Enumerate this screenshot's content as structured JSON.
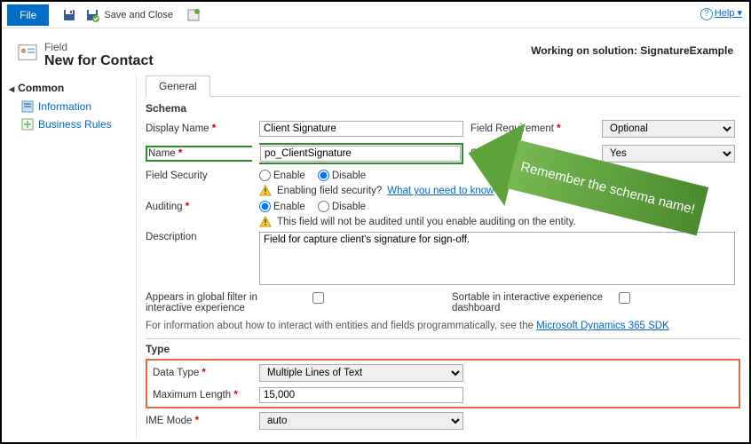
{
  "toolbar": {
    "file_label": "File",
    "save_close_label": "Save and Close",
    "help_label": "Help"
  },
  "header": {
    "entity_type": "Field",
    "title": "New for Contact",
    "solution_prefix": "Working on solution:",
    "solution_name": "SignatureExample"
  },
  "sidebar": {
    "group": "Common",
    "items": [
      {
        "label": "Information"
      },
      {
        "label": "Business Rules"
      }
    ]
  },
  "tabs": {
    "general": "General"
  },
  "schema": {
    "section_title": "Schema",
    "display_name_label": "Display Name",
    "display_name_value": "Client Signature",
    "field_req_label": "Field Requirement",
    "field_req_value": "Optional",
    "name_label": "Name",
    "name_value": "po_ClientSignature",
    "searchable_label": "Searchable",
    "searchable_value": "Yes",
    "field_security_label": "Field Security",
    "enable_label": "Enable",
    "disable_label": "Disable",
    "field_security_warn": "Enabling field security?",
    "field_security_link": "What you need to know",
    "auditing_label": "Auditing",
    "auditing_warn": "This field will not be audited until you enable auditing on the entity.",
    "description_label": "Description",
    "description_value": "Field for capture client's signature for sign-off.",
    "global_filter_label": "Appears in global filter in interactive experience",
    "sortable_label": "Sortable in interactive experience dashboard",
    "info_text": "For information about how to interact with entities and fields programmatically, see the",
    "info_link": "Microsoft Dynamics 365 SDK"
  },
  "type": {
    "section_title": "Type",
    "data_type_label": "Data Type",
    "data_type_value": "Multiple Lines of Text",
    "max_length_label": "Maximum Length",
    "max_length_value": "15,000",
    "ime_label": "IME Mode",
    "ime_value": "auto"
  },
  "annotation": {
    "text": "Remember the schema name!"
  }
}
